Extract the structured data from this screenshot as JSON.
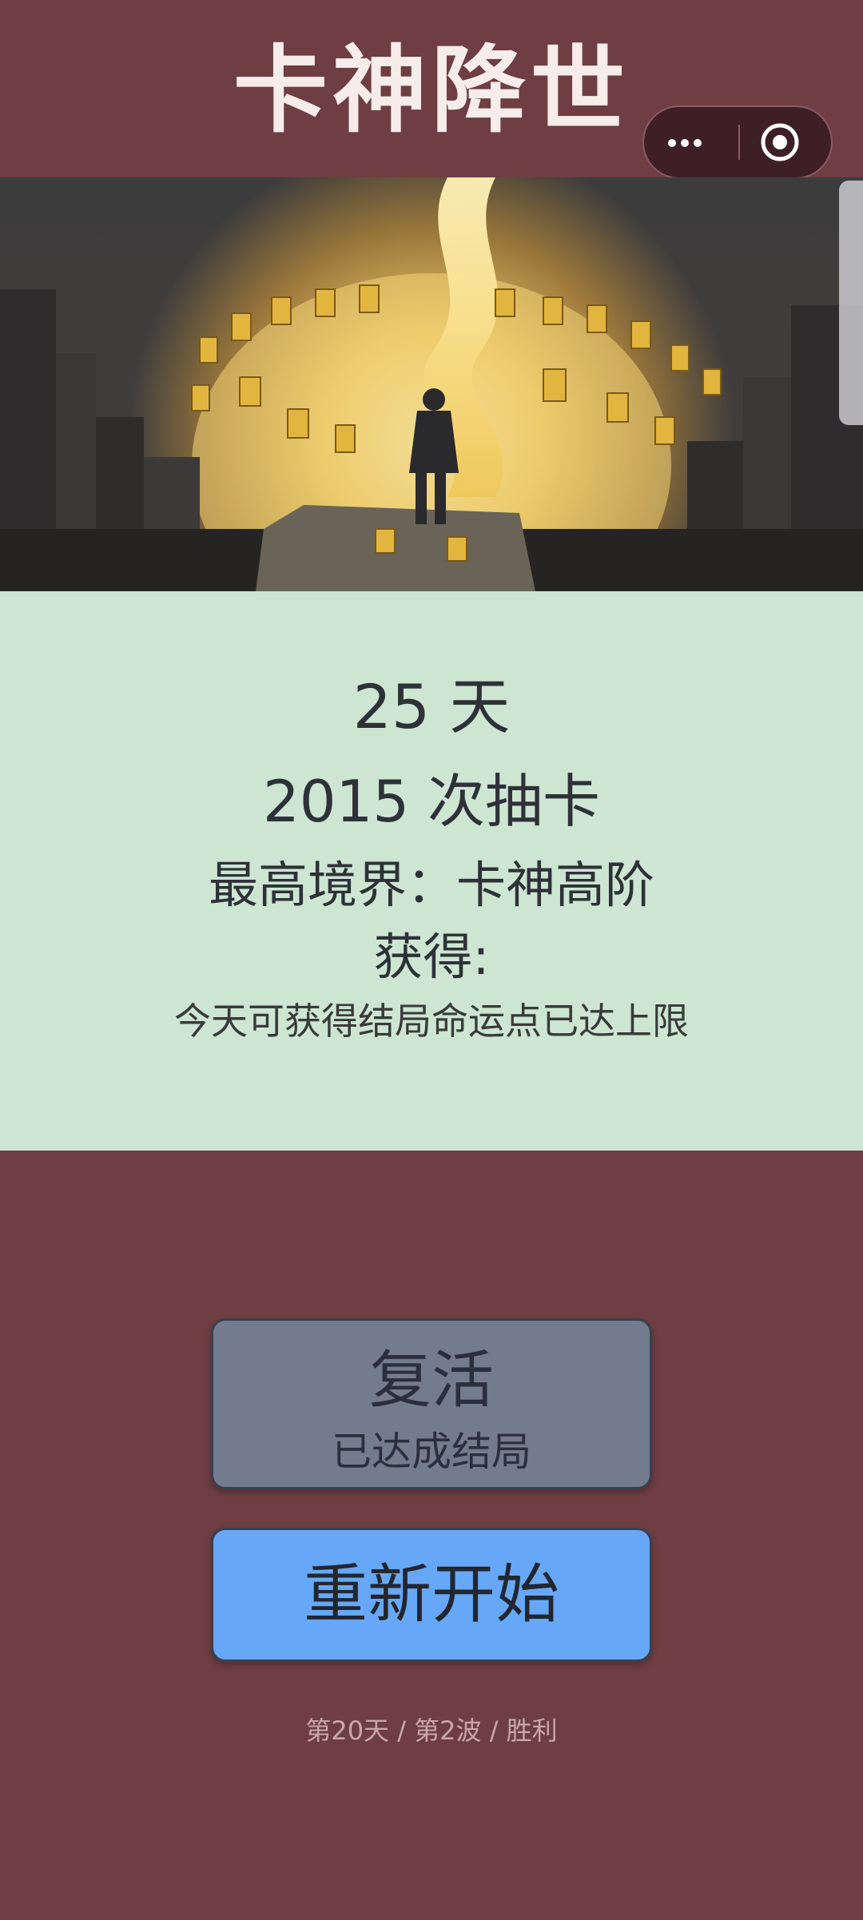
{
  "header": {
    "title": "卡神降世",
    "capsule": {
      "more_icon": "more-dots-icon",
      "close_icon": "target-circle-icon"
    }
  },
  "hero": {
    "image_icon": "hero-illustration"
  },
  "stats": {
    "days": "25 天",
    "draws": "2015 次抽卡",
    "realm": "最高境界：卡神高阶",
    "gain_label": "获得:",
    "note": "今天可获得结局命运点已达上限"
  },
  "actions": {
    "revive_label": "复活",
    "revive_sub": "已达成结局",
    "restart_label": "重新开始"
  },
  "footer": {
    "status": "第20天 / 第2波 / 胜利"
  },
  "colors": {
    "background": "#6e3e42",
    "stats_panel": "#cce6d2",
    "revive_button": "#737c8c",
    "restart_button": "#66a8f7"
  }
}
